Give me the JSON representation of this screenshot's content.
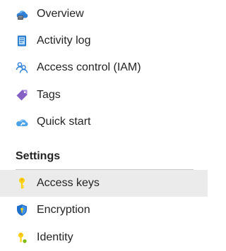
{
  "menu": {
    "items": [
      {
        "label": "Overview",
        "icon": "overview-cloud-icon"
      },
      {
        "label": "Activity log",
        "icon": "activity-log-icon"
      },
      {
        "label": "Access control (IAM)",
        "icon": "people-icon"
      },
      {
        "label": "Tags",
        "icon": "tag-icon"
      },
      {
        "label": "Quick start",
        "icon": "quick-start-cloud-icon"
      }
    ],
    "settings": {
      "title": "Settings",
      "items": [
        {
          "label": "Access keys",
          "icon": "key-icon",
          "selected": true
        },
        {
          "label": "Encryption",
          "icon": "shield-icon"
        },
        {
          "label": "Identity",
          "icon": "identity-icon"
        }
      ]
    }
  },
  "colors": {
    "selected_background": "#ebebeb",
    "text": "#242424",
    "divider": "#c8c8c8",
    "icon_blue": "#0078d4",
    "tag_purple": "#8661c5",
    "key_yellow": "#fcd116"
  }
}
